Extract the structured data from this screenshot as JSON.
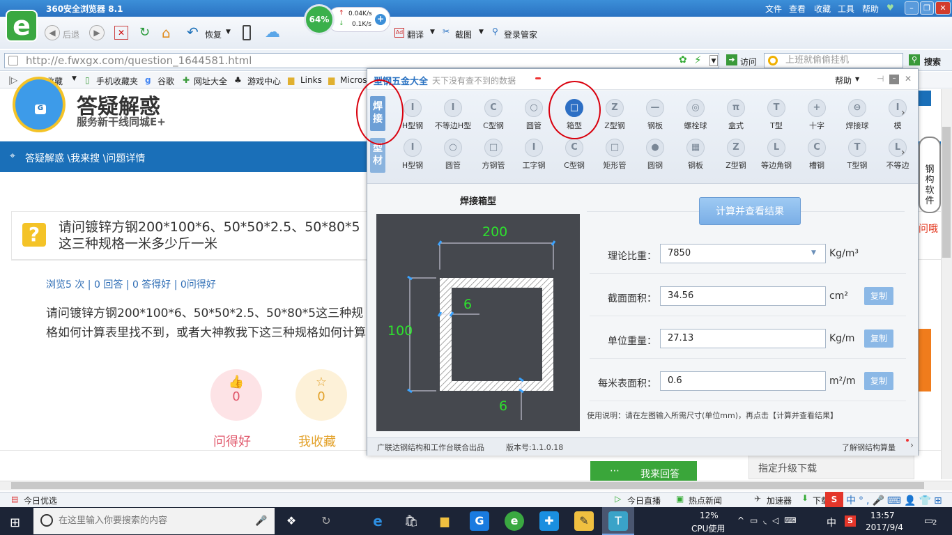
{
  "browser": {
    "title": "360安全浏览器 8.1",
    "menus": [
      "文件",
      "查看",
      "收藏",
      "工具",
      "帮助"
    ],
    "toolbar": {
      "back": "后退",
      "restore": "恢复",
      "translate": "翻译",
      "screenshot": "截图",
      "login": "登录管家",
      "speed_pct": "64%",
      "speed_up": "0.04K/s",
      "speed_down": "0.1K/s"
    },
    "address": {
      "url": "http://e.fwxgx.com/question_1644581.html",
      "visit": "访问",
      "search_placeholder": "上班就偷偷挂机",
      "search_btn": "搜索"
    },
    "bookmarks": [
      "收藏",
      "手机收藏夹",
      "谷歌",
      "网址大全",
      "游戏中心",
      "Links",
      "Micros"
    ]
  },
  "page": {
    "brand_title": "答疑解惑",
    "brand_sub": "服务新干线同城E+",
    "breadcrumb": "答疑解惑 \\我来搜 \\问题详情",
    "question_title": "请问镀锌方钢200*100*6、50*50*2.5、50*80*5这三种规格一米多少斤一米",
    "stats": "浏览5 次 | 0 回答 | 0 答得好 | 0问得好",
    "question_body": "请问镀锌方钢200*100*6、50*50*2.5、50*80*5这三种规格如何计算表里找不到，或者大神教我下这三种规格如何计算",
    "like_count": "0",
    "like_label": "问得好",
    "fav_count": "0",
    "fav_label": "我收藏",
    "answer_btn": "我来回答",
    "upgrade": "指定升级下载",
    "mascot_text": "钢构软件",
    "mascot_sub": "问哦"
  },
  "dialog": {
    "title": "型钢五金大全",
    "subtitle": "天下没有查不到的数据",
    "help": "帮助",
    "tab1": "焊接",
    "tab2": "型材",
    "row1": [
      {
        "label": "H型钢",
        "glyph": "I"
      },
      {
        "label": "不等边H型",
        "glyph": "I"
      },
      {
        "label": "C型钢",
        "glyph": "C"
      },
      {
        "label": "圆管",
        "glyph": "○"
      },
      {
        "label": "箱型",
        "glyph": "□",
        "selected": true
      },
      {
        "label": "Z型钢",
        "glyph": "Z"
      },
      {
        "label": "钢板",
        "glyph": "—"
      },
      {
        "label": "螺栓球",
        "glyph": "◎"
      },
      {
        "label": "盒式",
        "glyph": "π"
      },
      {
        "label": "T型",
        "glyph": "T"
      },
      {
        "label": "十字",
        "glyph": "+"
      },
      {
        "label": "焊接球",
        "glyph": "⊖"
      },
      {
        "label": "模",
        "glyph": "I"
      }
    ],
    "row2": [
      {
        "label": "H型钢",
        "glyph": "I"
      },
      {
        "label": "圆管",
        "glyph": "○"
      },
      {
        "label": "方钢管",
        "glyph": "□"
      },
      {
        "label": "工字钢",
        "glyph": "I"
      },
      {
        "label": "C型钢",
        "glyph": "C"
      },
      {
        "label": "矩形管",
        "glyph": "□"
      },
      {
        "label": "圆钢",
        "glyph": "●"
      },
      {
        "label": "钢板",
        "glyph": "▦"
      },
      {
        "label": "Z型钢",
        "glyph": "Z"
      },
      {
        "label": "等边角钢",
        "glyph": "L"
      },
      {
        "label": "槽钢",
        "glyph": "C"
      },
      {
        "label": "T型钢",
        "glyph": "T"
      },
      {
        "label": "不等边",
        "glyph": "L"
      }
    ],
    "section_title": "焊接箱型",
    "dim_width": "200",
    "dim_height": "100",
    "dim_t1": "6",
    "dim_t2": "6",
    "calc_btn": "计算并查看结果",
    "fields": [
      {
        "label": "理论比重：",
        "value": "7850",
        "unit": "Kg/m³",
        "copy": ""
      },
      {
        "label": "截面面积：",
        "value": "34.56",
        "unit": "cm²",
        "copy": "复制"
      },
      {
        "label": "单位重量：",
        "value": "27.13",
        "unit": "Kg/m",
        "copy": "复制"
      },
      {
        "label": "每米表面积：",
        "value": "0.6",
        "unit": "m²/m",
        "copy": "复制"
      }
    ],
    "usage": "使用说明：请在左图输入所需尺寸(单位mm)，再点击【计算并查看结果】",
    "footer_left": "广联达钢结构和工作台联合出品",
    "version": "版本号:1.1.0.18",
    "footer_right": "了解钢结构算量"
  },
  "statusbar": {
    "left": "今日优选",
    "items": [
      "今日直播",
      "热点新闻",
      "加速器",
      "下载"
    ]
  },
  "taskbar": {
    "search": "在这里输入你要搜索的内容",
    "cpu_pct": "12%",
    "cpu_label": "CPU使用",
    "ime": "中",
    "time": "13:57",
    "date": "2017/9/4",
    "notif": "2"
  }
}
